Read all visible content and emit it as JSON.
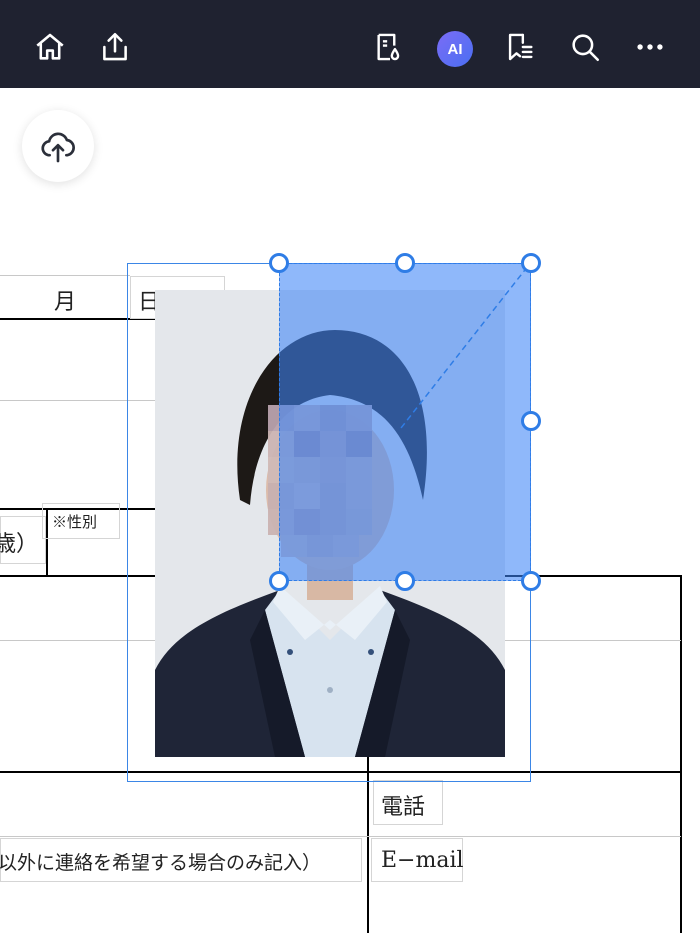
{
  "toolbar": {
    "icons": [
      "home-icon",
      "share-icon",
      "reader-mode-icon",
      "ai-assistant",
      "bookmark-list-icon",
      "search-icon",
      "more-icon"
    ],
    "ai_label": "AI",
    "background": "#1f2230"
  },
  "fab": {
    "icon": "cloud-upload-icon"
  },
  "document": {
    "month_label": "月",
    "date_label": "日現在",
    "age_label": "歳）",
    "gender_label": "※性別",
    "phone_label": "電話",
    "contact_note": "以外に連絡を希望する場合のみ記入）",
    "email_label": "E−mail"
  },
  "selection": {
    "accent": "#2f7de6",
    "crop_fill": "rgba(62,132,246,0.58)"
  }
}
